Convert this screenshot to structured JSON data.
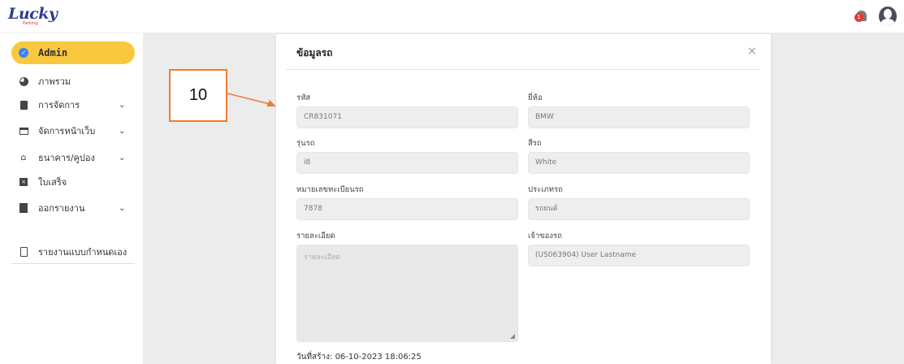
{
  "header": {
    "logo_text": "Lucky",
    "logo_sub": "Parking",
    "notification_count": "1"
  },
  "sidebar": {
    "items": [
      {
        "label": "Admin",
        "icon": "check-circle-icon"
      },
      {
        "label": "ภาพรวม",
        "icon": "pie-chart-icon"
      },
      {
        "label": "การจัดการ",
        "icon": "document-icon"
      },
      {
        "label": "จัดการหน้าเว็บ",
        "icon": "window-icon"
      },
      {
        "label": "ธนาคาร/คูปอง",
        "icon": "bank-icon"
      },
      {
        "label": "ใบเสร็จ",
        "icon": "receipt-icon"
      },
      {
        "label": "ออกรายงาน",
        "icon": "file-icon"
      },
      {
        "label": "รายงานแบบกำหนดเอง",
        "icon": "clipboard-icon"
      }
    ]
  },
  "annotation": {
    "label": "10",
    "color": "#ed7d31"
  },
  "modal": {
    "title": "ข้อมูลรถ",
    "close": "×",
    "fields": {
      "code_label": "รหัส",
      "code_value": "CR831071",
      "brand_label": "ยี่ห้อ",
      "brand_value": "BMW",
      "model_label": "รุ่นรถ",
      "model_value": "i8",
      "color_label": "สีรถ",
      "color_value": "White",
      "plate_label": "หมายเลขทะเบียนรถ",
      "plate_value": "7878",
      "type_label": "ประเภทรถ",
      "type_value": "รถยนต์",
      "detail_label": "รายละเอียด",
      "detail_placeholder": "รายละเอียด",
      "owner_label": "เจ้าของรถ",
      "owner_value": "(US063904) User Lastname"
    },
    "created": "วันที่สร้าง: 06-10-2023 18:06:25"
  },
  "colors": {
    "active_nav": "#f9c83f",
    "accent_blue": "#3b82f6",
    "notify": "#e53935"
  }
}
